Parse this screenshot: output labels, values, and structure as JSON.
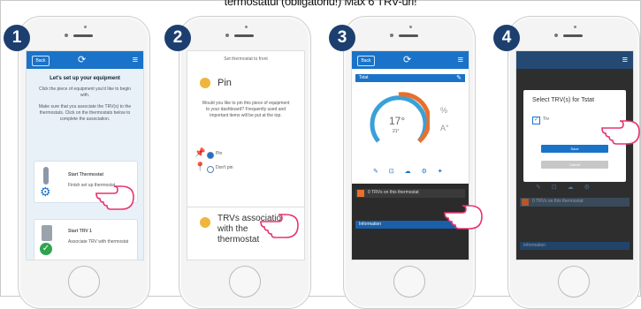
{
  "caption": "termostatul (obligatoriu!) Max 6 TRV-uri!",
  "colors": {
    "step_badge": "#1d3f70",
    "app_blue": "#1a73c8",
    "pin_dot": "#f0b53c",
    "green_check": "#2ea44f"
  },
  "steps": [
    "1",
    "2",
    "3",
    "4"
  ],
  "screen1": {
    "back_label": "Back",
    "title": "Let's set up your equipment",
    "intro": "Click the piece of equipment you'd like to begin with.",
    "hint": "Make sure that you associate the TRV(s) to the thermostats. Click on the thermostats below to complete the association.",
    "card1_title": "Start Thermostat",
    "card1_sub": "Finish set up thermostat",
    "card2_title": "Start TRV 1",
    "card2_sub": "Associate TRV with thermostat"
  },
  "screen2": {
    "top_text": "Set thermostat to front",
    "pin_label": "Pin",
    "pin_desc": "Would you like to pin this piece of equipment to your dashboard? Frequently used and important items will be put at the top.",
    "option_pin": "Pin",
    "option_dont": "Don't pin",
    "trv_label_line1": "TRVs association",
    "trv_label_line2": "with the",
    "trv_label_line3": "thermostat"
  },
  "screen3": {
    "back_label": "Back",
    "device_title": "Tstat",
    "temp_main": "17°",
    "temp_sub": "21°",
    "humidity": "%",
    "unit": "A°",
    "trv_bar": "0 TRVs on this thermostat",
    "info_bar": "Information"
  },
  "screen4": {
    "dialog_title": "Select TRV(s) for Tstat",
    "trv_item": "Trv",
    "save_label": "Save",
    "cancel_label": "Cancel",
    "bg_trv_bar": "0 TRVs on this thermostat",
    "bg_info_bar": "Information"
  }
}
